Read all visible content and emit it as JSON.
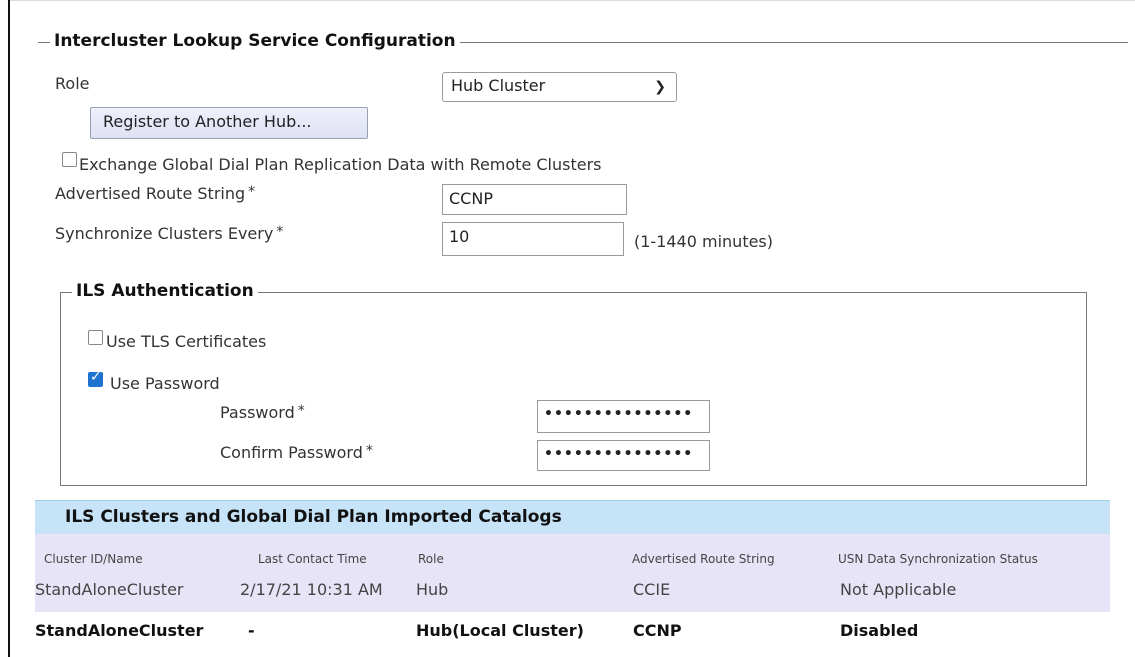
{
  "top_cut_text": "Intercluster Lookup Service Configuration",
  "ils_config": {
    "legend": "Intercluster Lookup Service Configuration",
    "role_label": "Role",
    "role_value": "Hub Cluster",
    "register_button": "Register to Another Hub...",
    "exchange_label": "Exchange Global Dial Plan Replication Data with Remote Clusters",
    "exchange_checked": false,
    "route_label": "Advertised Route String",
    "route_value": "CCNP",
    "sync_label": "Synchronize Clusters Every",
    "sync_value": "10",
    "sync_hint": "(1-1440 minutes)",
    "required_mark": "*"
  },
  "ils_auth": {
    "legend": "ILS Authentication",
    "tls_label": "Use TLS Certificates",
    "tls_checked": false,
    "password_label_cb": "Use Password",
    "password_checked": true,
    "password_label": "Password",
    "password_value": "•••••••••••••••",
    "confirm_label": "Confirm Password",
    "confirm_value": "•••••••••••••••"
  },
  "catalogs": {
    "title": "ILS Clusters and Global Dial Plan Imported Catalogs",
    "columns": [
      "Cluster ID/Name",
      "Last Contact Time",
      "Role",
      "Advertised Route String",
      "USN Data Synchronization Status"
    ],
    "rows": [
      [
        "StandAloneCluster",
        "2/17/21 10:31 AM",
        "Hub",
        "CCIE",
        "Not Applicable"
      ],
      [
        "StandAloneCluster",
        "-",
        "Hub(Local Cluster)",
        "CCNP",
        "Disabled"
      ]
    ]
  },
  "colors": {
    "header_bg": "#c6e3f7",
    "row_bg": "#e8e4f8",
    "checkbox_checked": "#1f73d0"
  }
}
